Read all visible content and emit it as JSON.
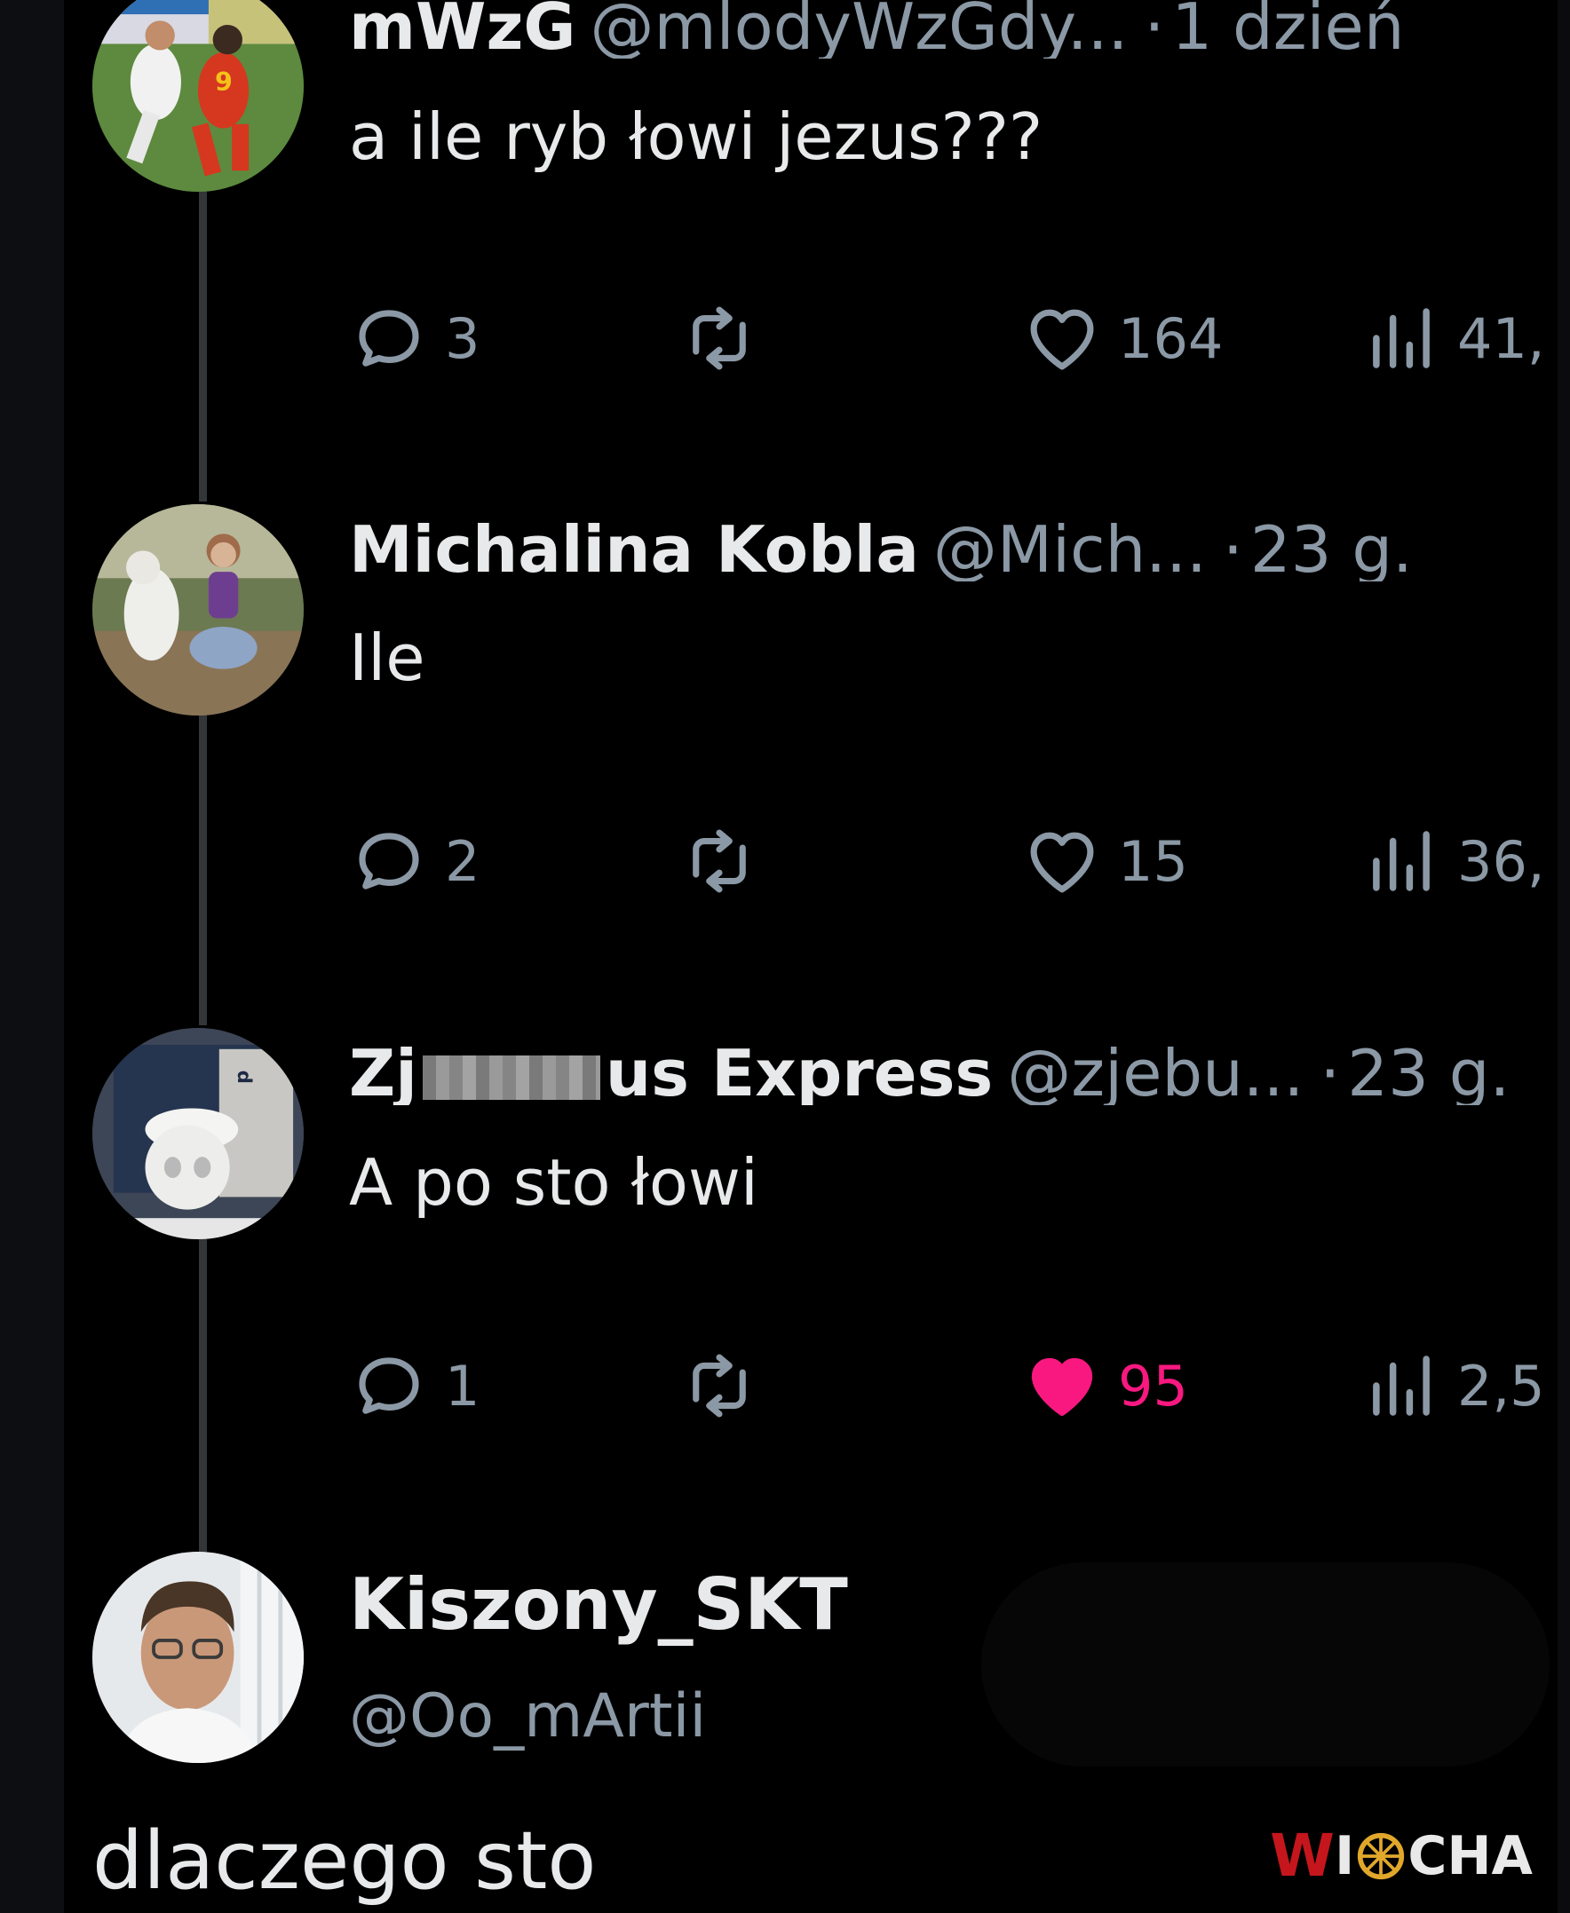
{
  "tweets": [
    {
      "name": "mWzG",
      "handle": "@mlodyWzGdy...",
      "separator": "·",
      "time": "1 dzień",
      "text": "a ile ryb łowi jezus???",
      "avatar": "football-player-avatar",
      "replies": "3",
      "likes": "164",
      "views": "41,",
      "liked": false
    },
    {
      "name": "Michalina Kobla",
      "handle": "@Mich...",
      "separator": "·",
      "time": "23 g.",
      "text": "Ile",
      "avatar": "girl-with-goat-avatar",
      "replies": "2",
      "likes": "15",
      "views": "36,",
      "liked": false
    },
    {
      "name_before_censor": "Zj",
      "name_after_censor": "us Express",
      "handle": "@zjebu...",
      "separator": "·",
      "time": "23 g.",
      "text": "A po sto łowi",
      "avatar": "skull-toilet-avatar",
      "replies": "1",
      "likes": "95",
      "views": "2,5",
      "liked": true
    }
  ],
  "final_reply": {
    "name": "Kiszony_SKT",
    "handle": "@Oo_mArtii",
    "text": "dlaczego sto",
    "avatar": "man-portrait-avatar"
  },
  "watermark": {
    "first_letter": "W",
    "middle": "I",
    "rest": "CHA"
  },
  "colors": {
    "background": "#000000",
    "text_primary": "#e7e9ea",
    "text_secondary": "#8b98a5",
    "like_active": "#f91880",
    "thread_line": "#333639",
    "watermark_red": "#c4161c",
    "watermark_wheel": "#e0a72b"
  }
}
